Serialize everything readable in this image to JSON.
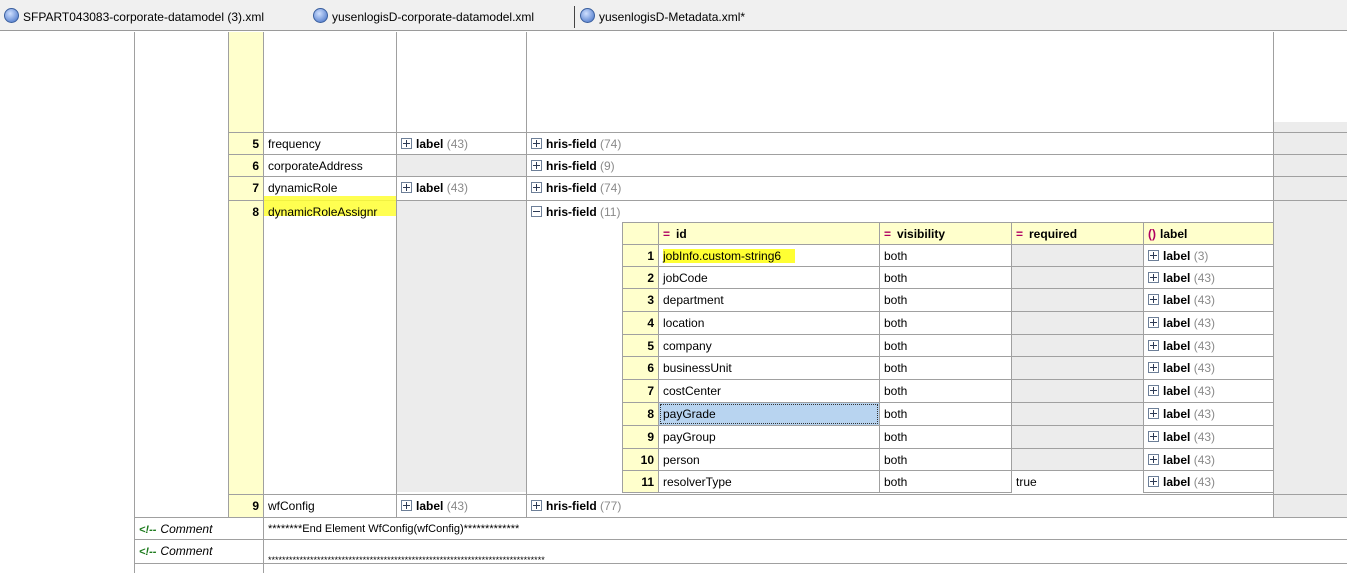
{
  "tabs": [
    {
      "label": "SFPART043083-corporate-datamodel (3).xml",
      "icon": "xml-file-icon"
    },
    {
      "label": "yusenlogisD-corporate-datamodel.xml",
      "icon": "xml-file-icon"
    },
    {
      "label": "yusenlogisD-Metadata.xml*",
      "icon": "xml-file-icon"
    }
  ],
  "rows": [
    {
      "num": "5",
      "name": "frequency",
      "label_col": "label",
      "label_count": "(43)",
      "field": "hris-field",
      "field_count": "(74)"
    },
    {
      "num": "6",
      "name": "corporateAddress",
      "label_col": "",
      "label_count": "",
      "field": "hris-field",
      "field_count": "(9)"
    },
    {
      "num": "7",
      "name": "dynamicRole",
      "label_col": "label",
      "label_count": "(43)",
      "field": "hris-field",
      "field_count": "(74)"
    },
    {
      "num": "8",
      "name": "dynamicRoleAssignr",
      "label_col": "",
      "label_count": "",
      "field": "hris-field",
      "field_count": "(11)"
    },
    {
      "num": "9",
      "name": "wfConfig",
      "label_col": "label",
      "label_count": "(43)",
      "field": "hris-field",
      "field_count": "(77)"
    }
  ],
  "inner_table": {
    "headers": {
      "id": "id",
      "visibility": "visibility",
      "required": "required",
      "label": "label"
    },
    "rows": [
      {
        "num": "1",
        "id": "jobInfo.custom-string6",
        "visibility": "both",
        "required": "",
        "label": "label",
        "count": "(3)"
      },
      {
        "num": "2",
        "id": "jobCode",
        "visibility": "both",
        "required": "",
        "label": "label",
        "count": "(43)"
      },
      {
        "num": "3",
        "id": "department",
        "visibility": "both",
        "required": "",
        "label": "label",
        "count": "(43)"
      },
      {
        "num": "4",
        "id": "location",
        "visibility": "both",
        "required": "",
        "label": "label",
        "count": "(43)"
      },
      {
        "num": "5",
        "id": "company",
        "visibility": "both",
        "required": "",
        "label": "label",
        "count": "(43)"
      },
      {
        "num": "6",
        "id": "businessUnit",
        "visibility": "both",
        "required": "",
        "label": "label",
        "count": "(43)"
      },
      {
        "num": "7",
        "id": "costCenter",
        "visibility": "both",
        "required": "",
        "label": "label",
        "count": "(43)"
      },
      {
        "num": "8",
        "id": "payGrade",
        "visibility": "both",
        "required": "",
        "label": "label",
        "count": "(43)"
      },
      {
        "num": "9",
        "id": "payGroup",
        "visibility": "both",
        "required": "",
        "label": "label",
        "count": "(43)"
      },
      {
        "num": "10",
        "id": "person",
        "visibility": "both",
        "required": "",
        "label": "label",
        "count": "(43)"
      },
      {
        "num": "11",
        "id": "resolverType",
        "visibility": "both",
        "required": "true",
        "label": "label",
        "count": "(43)"
      }
    ]
  },
  "comments": [
    {
      "tag": "Comment",
      "text": "********End Element WfConfig(wfConfig)*************"
    },
    {
      "tag": "Comment",
      "text": "*******************************************************************************"
    }
  ],
  "colors": {
    "row_num_bg": "#ffffcc",
    "header_bg": "#ffffcc",
    "highlight": "#ffff33",
    "selected": "#b8d4f0",
    "empty_cell": "#ececec"
  }
}
